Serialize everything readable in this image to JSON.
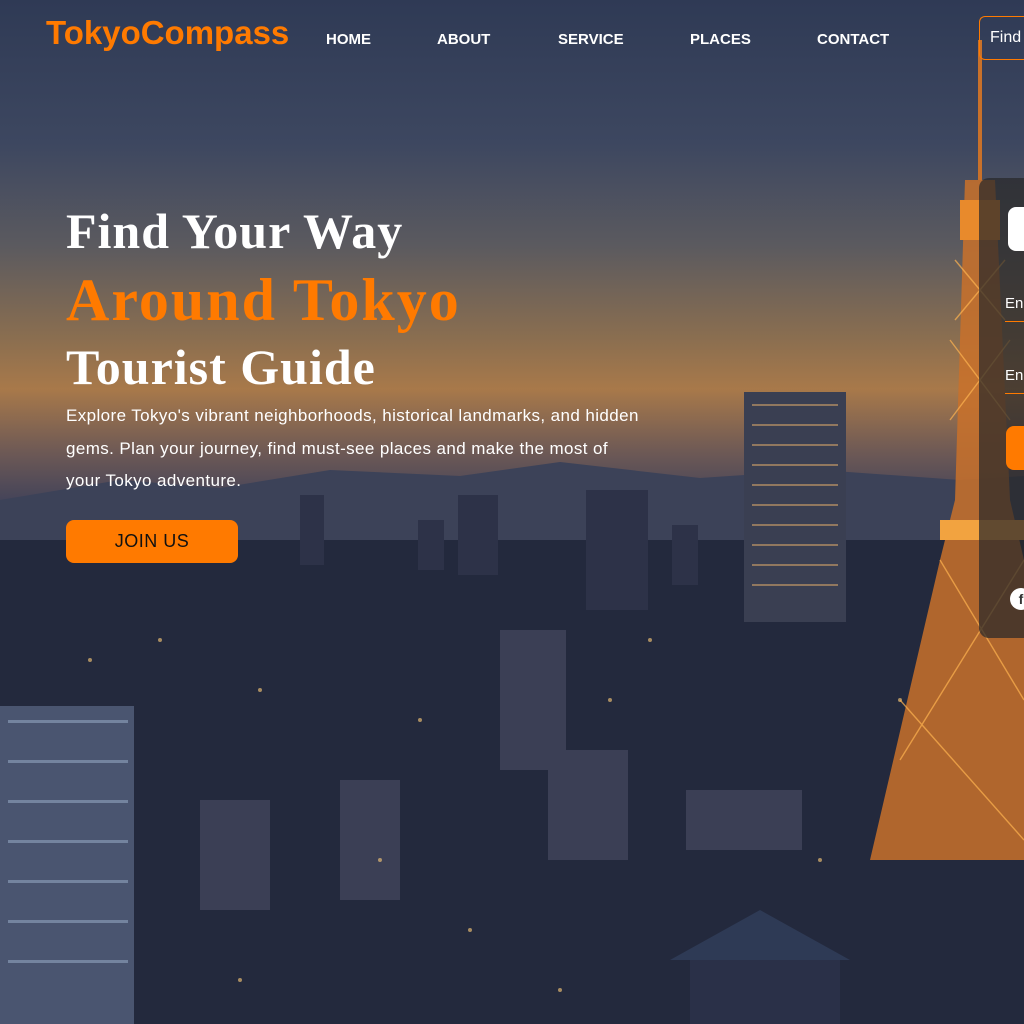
{
  "brand": {
    "logo": "TokyoCompass"
  },
  "nav": {
    "items": [
      {
        "label": "HOME"
      },
      {
        "label": "ABOUT"
      },
      {
        "label": "SERVICE"
      },
      {
        "label": "PLACES"
      },
      {
        "label": "CONTACT"
      }
    ],
    "search_placeholder": "Find"
  },
  "hero": {
    "title_line1": "Find Your Way",
    "title_line2": "Around Tokyo",
    "title_line3": "Tourist Guide",
    "description": "Explore Tokyo's vibrant neighborhoods, historical landmarks, and hidden gems. Plan your journey, find must-see places and make the most of your Tokyo adventure.",
    "cta_label": "JOIN US"
  },
  "login_panel": {
    "email_placeholder": "En",
    "password_placeholder": "En",
    "social_icon_label": "f"
  },
  "colors": {
    "accent": "#ff7a00",
    "text": "#ffffff"
  },
  "icons": {
    "social": "facebook-icon"
  }
}
